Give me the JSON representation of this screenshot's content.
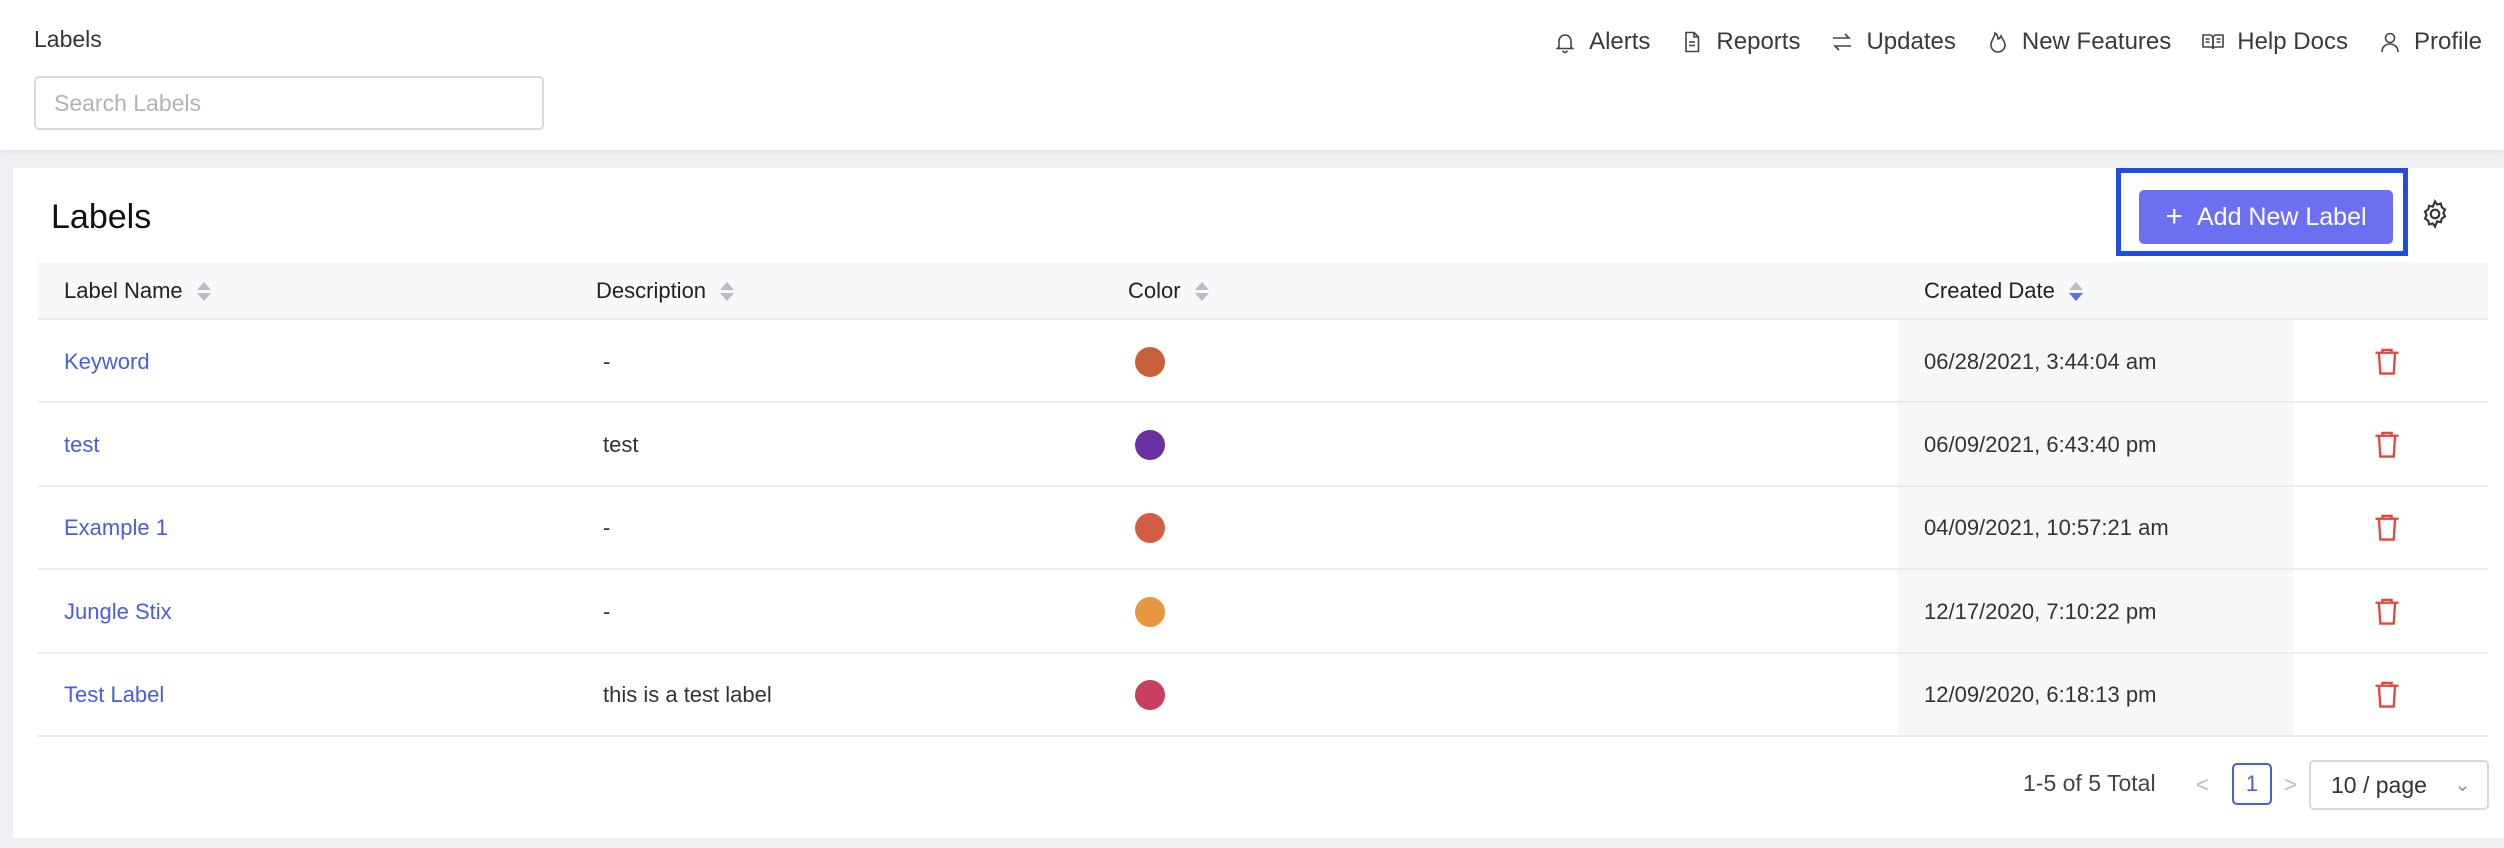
{
  "header": {
    "breadcrumb": "Labels",
    "search_placeholder": "Search Labels",
    "nav": [
      {
        "label": "Alerts",
        "icon": "bell-icon"
      },
      {
        "label": "Reports",
        "icon": "document-icon"
      },
      {
        "label": "Updates",
        "icon": "swap-arrows-icon"
      },
      {
        "label": "New Features",
        "icon": "flame-icon"
      },
      {
        "label": "Help Docs",
        "icon": "book-icon"
      },
      {
        "label": "Profile",
        "icon": "user-icon"
      }
    ]
  },
  "main": {
    "title": "Labels",
    "add_button_label": "Add New Label",
    "accent_color": "#6b6ff0",
    "highlight_color": "#1f4de4",
    "columns": {
      "name": "Label Name",
      "description": "Description",
      "color": "Color",
      "created": "Created Date"
    },
    "rows": [
      {
        "name": "Keyword",
        "description": "-",
        "color": "#c8603a",
        "created": "06/28/2021, 3:44:04 am"
      },
      {
        "name": "test",
        "description": "test",
        "color": "#6b2fa3",
        "created": "06/09/2021, 6:43:40 pm"
      },
      {
        "name": "Example 1",
        "description": "-",
        "color": "#d35d44",
        "created": "04/09/2021, 10:57:21 am"
      },
      {
        "name": "Jungle Stix",
        "description": "-",
        "color": "#e8973e",
        "created": "12/17/2020, 7:10:22 pm"
      },
      {
        "name": "Test Label",
        "description": "this is a test label",
        "color": "#c93f5f",
        "created": "12/09/2020, 6:18:13 pm"
      }
    ]
  },
  "pagination": {
    "total_text": "1-5 of 5 Total",
    "current_page": "1",
    "page_size": "10 / page",
    "prev": "<",
    "next": ">"
  }
}
